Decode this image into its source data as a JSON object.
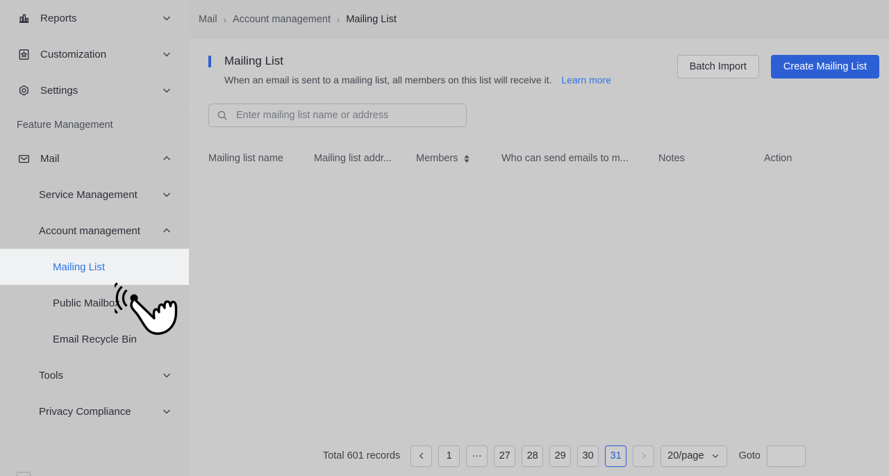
{
  "colors": {
    "accent_blue": "#2f5fd4",
    "link_blue": "#2f74e8",
    "sidebar_bg": "#c6c6c6",
    "content_bg": "#cacaca",
    "breadcrumb_bg": "#c4c4c4",
    "active_item_bg": "#eff1f3"
  },
  "sidebar": {
    "items": [
      {
        "label": "Reports",
        "icon": "bar-chart-icon",
        "level": 1,
        "chevron": "chevron-down",
        "active": false
      },
      {
        "label": "Customization",
        "icon": "star-frame-icon",
        "level": 1,
        "chevron": "chevron-down",
        "active": false
      },
      {
        "label": "Settings",
        "icon": "gear-icon",
        "level": 1,
        "chevron": "chevron-down",
        "active": false
      }
    ],
    "section_label": "Feature Management",
    "feature_items": [
      {
        "label": "Mail",
        "icon": "envelope-icon",
        "level": 1,
        "chevron": "chevron-up",
        "active": false
      },
      {
        "label": "Service Management",
        "icon": "",
        "level": 2,
        "chevron": "chevron-down",
        "active": false
      },
      {
        "label": "Account management",
        "icon": "",
        "level": 2,
        "chevron": "chevron-up",
        "active": false
      },
      {
        "label": "Mailing List",
        "icon": "",
        "level": 3,
        "chevron": "",
        "active": true
      },
      {
        "label": "Public Mailbox",
        "icon": "",
        "level": 3,
        "chevron": "",
        "active": false
      },
      {
        "label": "Email Recycle Bin",
        "icon": "",
        "level": 3,
        "chevron": "",
        "active": false
      },
      {
        "label": "Tools",
        "icon": "",
        "level": 2,
        "chevron": "chevron-down",
        "active": false
      },
      {
        "label": "Privacy Compliance",
        "icon": "",
        "level": 2,
        "chevron": "chevron-down",
        "active": false
      }
    ]
  },
  "breadcrumb": {
    "items": [
      "Mail",
      "Account management",
      "Mailing List"
    ],
    "separator": "›"
  },
  "header": {
    "title": "Mailing List",
    "subtitle": "When an email is sent to a mailing list, all members on this list will receive it.",
    "learn_more": "Learn more",
    "batch_import_label": "Batch Import",
    "create_label": "Create Mailing List"
  },
  "search": {
    "placeholder": "Enter mailing list name or address",
    "value": "",
    "icon": "search-icon"
  },
  "table": {
    "columns": [
      {
        "label": "Mailing list name",
        "sortable": false
      },
      {
        "label": "Mailing list addr...",
        "sortable": false
      },
      {
        "label": "Members",
        "sortable": true
      },
      {
        "label": "Who can send emails to m...",
        "sortable": false
      },
      {
        "label": "Notes",
        "sortable": false
      },
      {
        "label": "Action",
        "sortable": false
      }
    ],
    "rows": []
  },
  "pagination": {
    "total_text": "Total 601 records",
    "prev_icon": "chevron-left-icon",
    "next_icon": "chevron-right-icon",
    "pages": [
      "1",
      "···",
      "27",
      "28",
      "29",
      "30",
      "31"
    ],
    "current_page": "31",
    "page_size_label": "20/page",
    "goto_label": "Goto",
    "goto_value": ""
  },
  "cursor": {
    "icon": "tap-hand-cursor"
  }
}
